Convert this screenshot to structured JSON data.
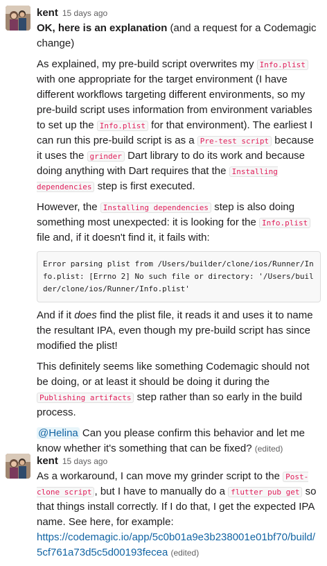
{
  "messages": [
    {
      "author": "kent",
      "timestamp": "15 days ago",
      "p1_bold": "OK, here is an explanation",
      "p1_rest": " (and a request for a Codemagic change)",
      "p2_a": "As explained, my pre-build script overwrites my ",
      "p2_code1": "Info.plist",
      "p2_b": " with one appropriate for the target environment (I have different workflows targeting different environments, so my pre-build script uses information from environment variables to set up the ",
      "p2_code2": "Info.plist",
      "p2_c": " for that environment). The earliest I can run this pre-build script is as a ",
      "p2_code3": "Pre-test script",
      "p2_d": " because it uses the ",
      "p2_code4": "grinder",
      "p2_e": " Dart library to do its work and because doing anything with Dart requires that the ",
      "p2_code5": "Installing dependencies",
      "p2_f": " step is first executed.",
      "p3_a": "However, the ",
      "p3_code1": "Installing dependencies",
      "p3_b": " step is also doing something most unexpected: it is looking for the ",
      "p3_code2": "Info.plist",
      "p3_c": " file and, if it doesn't find it, it fails with:",
      "code_block": "Error parsing plist from /Users/builder/clone/ios/Runner/Info.plist: [Errno 2] No such file or directory: '/Users/builder/clone/ios/Runner/Info.plist'",
      "p4_a": "And if it ",
      "p4_em": "does",
      "p4_b": " find the plist file, it reads it and uses it to name the resultant IPA, even though my pre-build script has since modified the plist!",
      "p5_a": "This definitely seems like something Codemagic should not be doing, or at least it should be doing it during the ",
      "p5_code1": "Publishing artifacts",
      "p5_b": " step rather than so early in the build process.",
      "p6_mention": "@Helina",
      "p6_text": " Can you please confirm this behavior and let me know whether it's something that can be fixed? ",
      "edited": "(edited)"
    },
    {
      "author": "kent",
      "timestamp": "15 days ago",
      "q1_a": "As a workaround, I can move my grinder script to the ",
      "q1_code1": "Post-clone script",
      "q1_b": ", but I have to manually do a ",
      "q1_code2": "flutter pub get",
      "q1_c": " so that things install correctly. If I do that, I get the expected IPA name. See here, for example:",
      "link": "https://codemagic.io/app/5c0b01a9e3b238001e01bf70/build/5cf761a73d5c5d00193fecea",
      "edited": "(edited)"
    }
  ],
  "colors": {
    "code_text": "#e01e5a",
    "link": "#1264a3",
    "muted": "#616061"
  }
}
